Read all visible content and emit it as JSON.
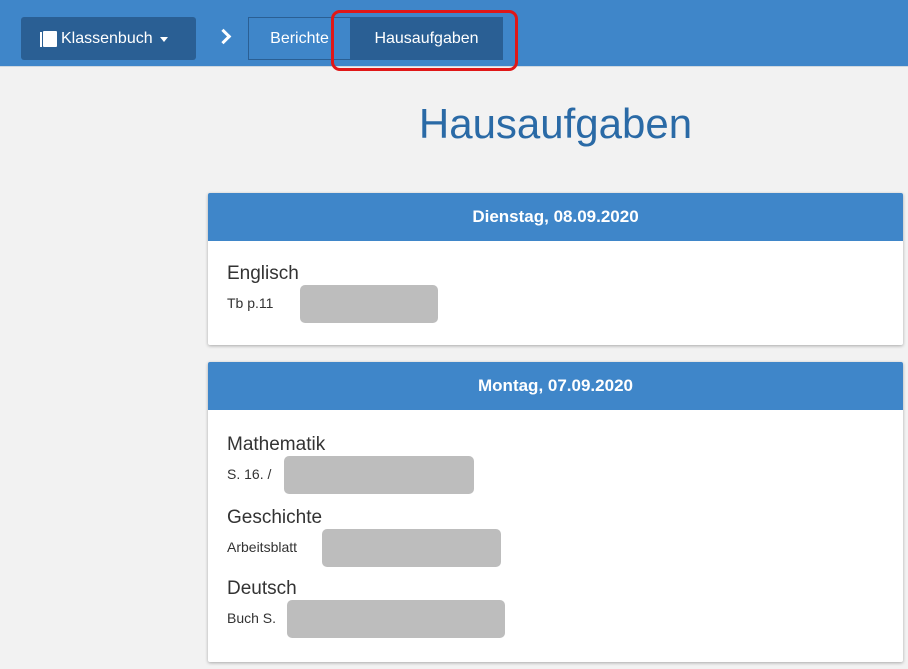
{
  "nav": {
    "klassenbuch_label": "Klassenbuch",
    "crumbs": [
      {
        "label": "Berichte"
      },
      {
        "label": "Hausaufgaben"
      }
    ]
  },
  "page": {
    "title": "Hausaufgaben"
  },
  "days": [
    {
      "date": "Dienstag, 08.09.2020",
      "entries": [
        {
          "subject": "Englisch",
          "task": "Tb p.11"
        }
      ]
    },
    {
      "date": "Montag, 07.09.2020",
      "entries": [
        {
          "subject": "Mathematik",
          "task": "S. 16. /"
        },
        {
          "subject": "Geschichte",
          "task": "Arbeitsblatt"
        },
        {
          "subject": "Deutsch",
          "task": "Buch S."
        }
      ]
    }
  ],
  "colors": {
    "primary": "#3f86c9",
    "primary_dark": "#2a5f94",
    "title": "#2a6aa6",
    "highlight": "#e01717",
    "redaction": "#bdbdbd"
  }
}
